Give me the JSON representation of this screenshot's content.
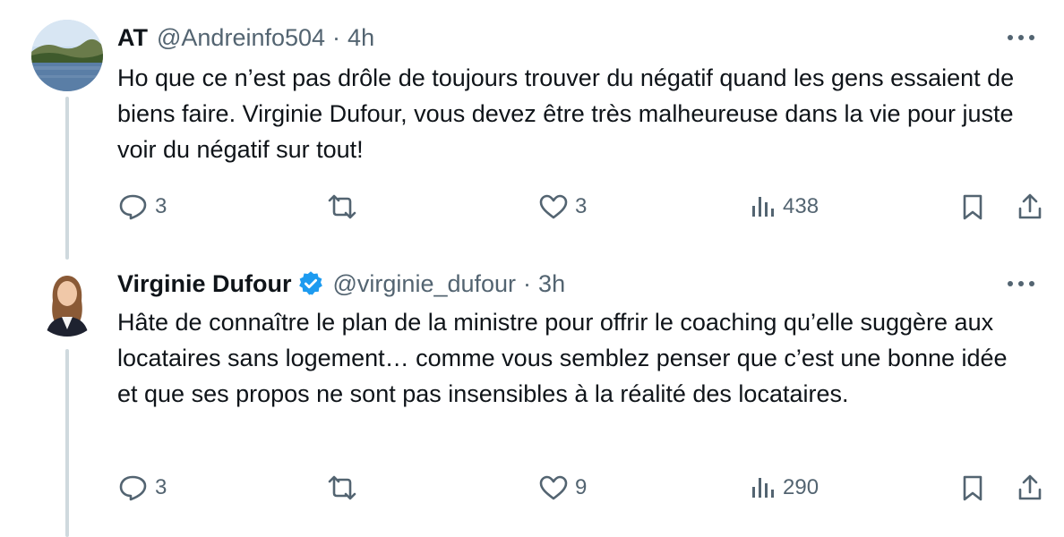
{
  "tweets": [
    {
      "name": "AT",
      "handle": "@Andreinfo504",
      "separator": "·",
      "time": "4h",
      "verified": false,
      "text": "Ho que ce n’est pas drôle de toujours trouver du négatif quand les gens essaient de biens faire. Virginie Dufour, vous devez être très malheureuse dans la vie pour juste voir du négatif sur tout!",
      "replies": "3",
      "retweets": "",
      "likes": "3",
      "views": "438"
    },
    {
      "name": "Virginie Dufour",
      "handle": "@virginie_dufour",
      "separator": "·",
      "time": "3h",
      "verified": true,
      "text": "Hâte de connaître le plan de la ministre pour offrir le coaching qu’elle suggère aux locataires sans logement… comme vous semblez penser que c’est une bonne idée et que ses propos ne sont pas insensibles à la réalité des locataires.",
      "replies": "3",
      "retweets": "",
      "likes": "9",
      "views": "290"
    }
  ],
  "icons": {
    "reply": "reply-icon",
    "retweet": "retweet-icon",
    "like": "heart-icon",
    "views": "views-icon",
    "bookmark": "bookmark-icon",
    "share": "share-icon",
    "more": "more-icon",
    "verified": "verified-badge-icon"
  },
  "colors": {
    "text": "#0f1419",
    "secondary": "#536471",
    "verified": "#1d9bf0",
    "thread_line": "#cfd9de"
  }
}
